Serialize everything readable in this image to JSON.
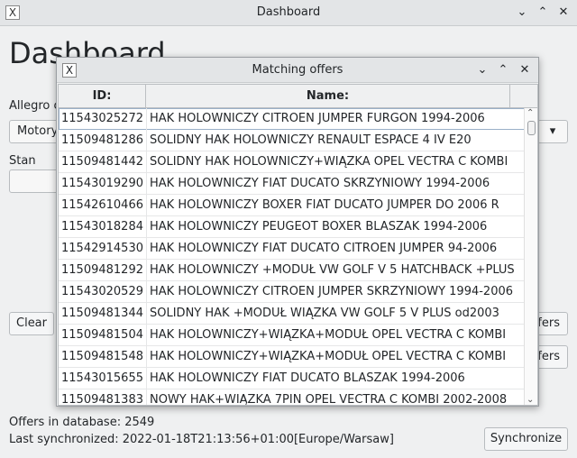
{
  "window": {
    "title": "Dashboard",
    "app_icon_glyph": "X",
    "controls": [
      "chevron-down-icon",
      "chevron-up-icon",
      "close-icon"
    ]
  },
  "dashboard": {
    "heading": "Dashboard",
    "allegro_label": "Allegro c",
    "category_value": "Motory",
    "stan_label": "Stan",
    "clear_label": "Clear",
    "offers_btn_1": "ffers",
    "offers_btn_2": "ffers",
    "offers_in_db": "Offers in database: 2549",
    "last_sync": "Last synchronized: 2022-01-18T21:13:56+01:00[Europe/Warsaw]",
    "synchronize_label": "Synchronize"
  },
  "dialog": {
    "title": "Matching offers",
    "columns": [
      "ID:",
      "Name:"
    ],
    "rows": [
      {
        "id": "11543025272",
        "name": "HAK HOLOWNICZY CITROEN JUMPER FURGON 1994-2006"
      },
      {
        "id": "11509481286",
        "name": "SOLIDNY HAK HOLOWNICZY RENAULT ESPACE 4 IV E20"
      },
      {
        "id": "11509481442",
        "name": "SOLIDNY HAK HOLOWNICZY+WIĄZKA OPEL VECTRA C KOMBI"
      },
      {
        "id": "11543019290",
        "name": "HAK HOLOWNICZY FIAT DUCATO SKRZYNIOWY 1994-2006"
      },
      {
        "id": "11542610466",
        "name": "HAK HOLOWNICZY BOXER FIAT DUCATO JUMPER DO 2006 R"
      },
      {
        "id": "11543018284",
        "name": "HAK HOLOWNICZY PEUGEOT BOXER BLASZAK 1994-2006"
      },
      {
        "id": "11542914530",
        "name": "HAK HOLOWNICZY FIAT DUCATO CITROEN JUMPER 94-2006"
      },
      {
        "id": "11509481292",
        "name": "HAK HOLOWNICZY +MODUŁ VW GOLF V 5 HATCHBACK +PLUS"
      },
      {
        "id": "11543020529",
        "name": "HAK HOLOWNICZY CITROEN JUMPER SKRZYNIOWY 1994-2006"
      },
      {
        "id": "11509481344",
        "name": "SOLIDNY HAK +MODUŁ WIĄZKA VW GOLF 5 V PLUS od2003"
      },
      {
        "id": "11509481504",
        "name": "HAK HOLOWNICZY+WIĄZKA+MODUŁ OPEL VECTRA C KOMBI"
      },
      {
        "id": "11509481548",
        "name": "HAK HOLOWNICZY+WIĄZKA+MODUŁ OPEL VECTRA C KOMBI"
      },
      {
        "id": "11543015655",
        "name": "HAK HOLOWNICZY FIAT DUCATO BLASZAK 1994-2006"
      },
      {
        "id": "11509481383",
        "name": "NOWY HAK+WIĄZKA 7PIN OPEL VECTRA C KOMBI 2002-2008"
      }
    ]
  }
}
